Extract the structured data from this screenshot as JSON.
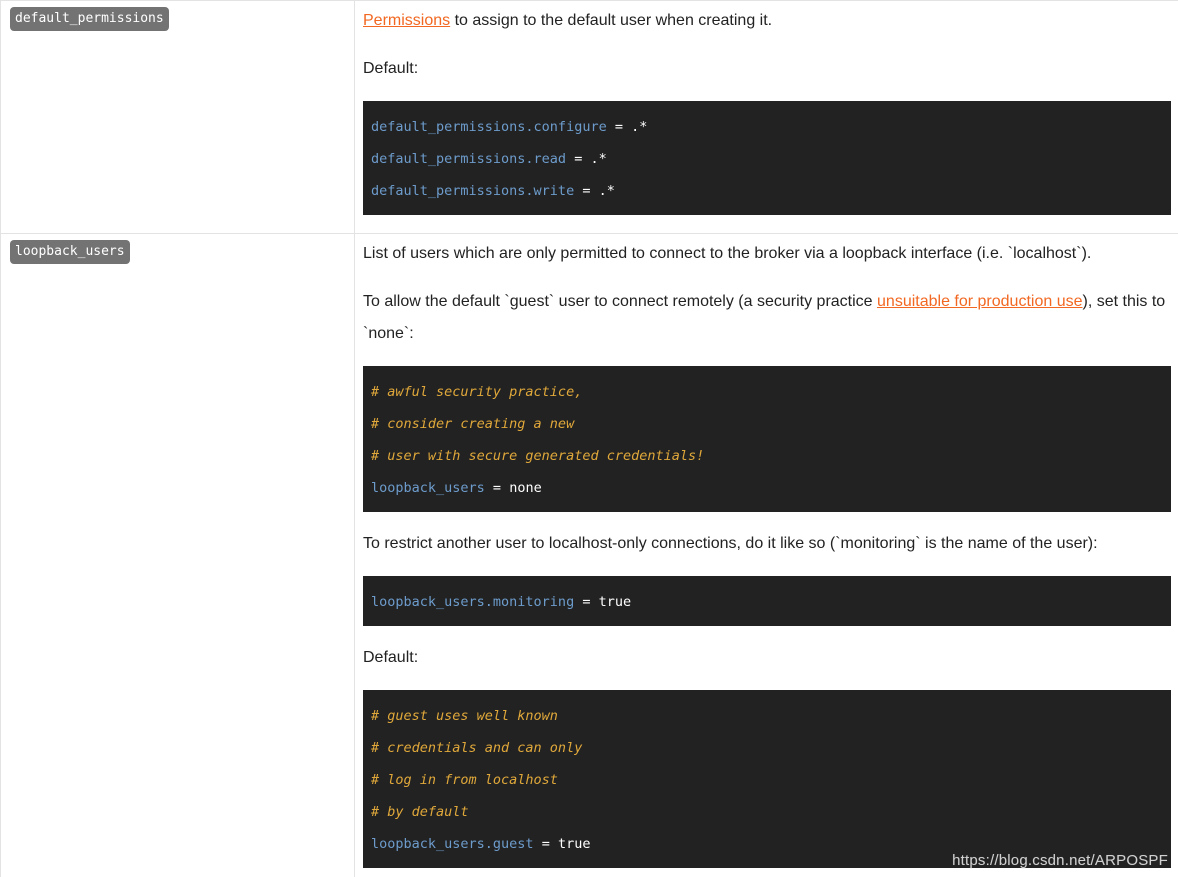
{
  "colors": {
    "badge_bg": "#737373",
    "link": "#f26822",
    "code_bg": "#222222",
    "code_key": "#6d9ccc",
    "code_comment": "#e0a83a"
  },
  "rows": [
    {
      "key": "default_permissions",
      "description": {
        "link_text": "Permissions",
        "text_after_link": " to assign to the default user when creating it."
      },
      "default_label": "Default:",
      "code": [
        {
          "key": "default_permissions.configure",
          "op": " = ",
          "value": ".*"
        },
        {
          "key": "default_permissions.read",
          "op": " = ",
          "value": ".*"
        },
        {
          "key": "default_permissions.write",
          "op": " = ",
          "value": ".*"
        }
      ]
    },
    {
      "key": "loopback_users",
      "intro": "List of users which are only permitted to connect to the broker via a loopback interface (i.e. `localhost`).",
      "remote_text_before": "To allow the default `guest` user to connect remotely (a security practice ",
      "remote_link": "unsuitable for production use",
      "remote_text_after": "), set this to `none`:",
      "code_none": {
        "comments": [
          "# awful security practice,",
          "# consider creating a new",
          "# user with secure generated credentials!"
        ],
        "key": "loopback_users",
        "op": " = ",
        "value": "none"
      },
      "restrict_text": "To restrict another user to localhost-only connections, do it like so (`monitoring` is the name of the user):",
      "code_monitoring": {
        "key": "loopback_users.monitoring",
        "op": " = ",
        "value": "true"
      },
      "default_label": "Default:",
      "code_default": {
        "comments": [
          "# guest uses well known",
          "# credentials and can only",
          "# log in from localhost",
          "# by default"
        ],
        "key": "loopback_users.guest",
        "op": " = ",
        "value": "true"
      }
    }
  ],
  "watermark": "https://blog.csdn.net/ARPOSPF"
}
